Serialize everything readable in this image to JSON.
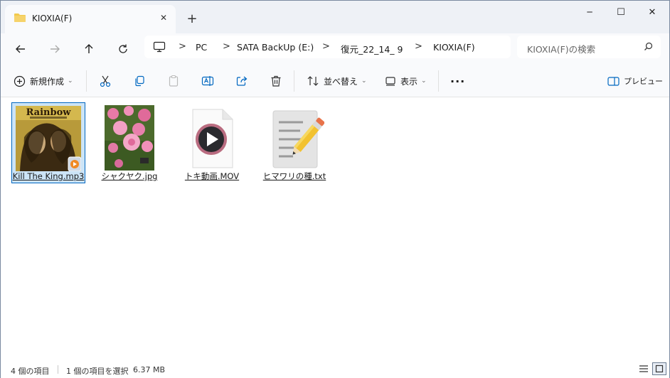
{
  "window": {
    "tab_title": "KIOXIA(F)",
    "new_tab": "+",
    "controls": {
      "minimize": "─",
      "maximize": "☐",
      "close": "✕"
    }
  },
  "breadcrumb": [
    "PC",
    "SATA BackUp (E:)",
    "復元_22_14_ 9",
    "KIOXIA(F)"
  ],
  "breadcrumb_sep": ">",
  "search": {
    "placeholder": "KIOXIA(F)の検索"
  },
  "toolbar": {
    "new_label": "新規作成",
    "sort_label": "並べ替え",
    "view_label": "表示",
    "more_label": "···",
    "preview_label": "プレビュー"
  },
  "files": [
    {
      "name": "Kill The King.mp3",
      "type": "audio-album-art",
      "selected": true
    },
    {
      "name": "シャクヤク.jpg",
      "type": "image-peony"
    },
    {
      "name": "トキ動画.MOV",
      "type": "video"
    },
    {
      "name": "ヒマワリの種.txt",
      "type": "text"
    }
  ],
  "album_text": "Rainbow",
  "status": {
    "count": "4 個の項目",
    "selection": "1 個の項目を選択",
    "size": "6.37 MB"
  },
  "colors": {
    "accent": "#0067c0",
    "selected_bg": "#cce4f7",
    "tabbar": "#eef1f6",
    "folder": "#f2c94c"
  }
}
